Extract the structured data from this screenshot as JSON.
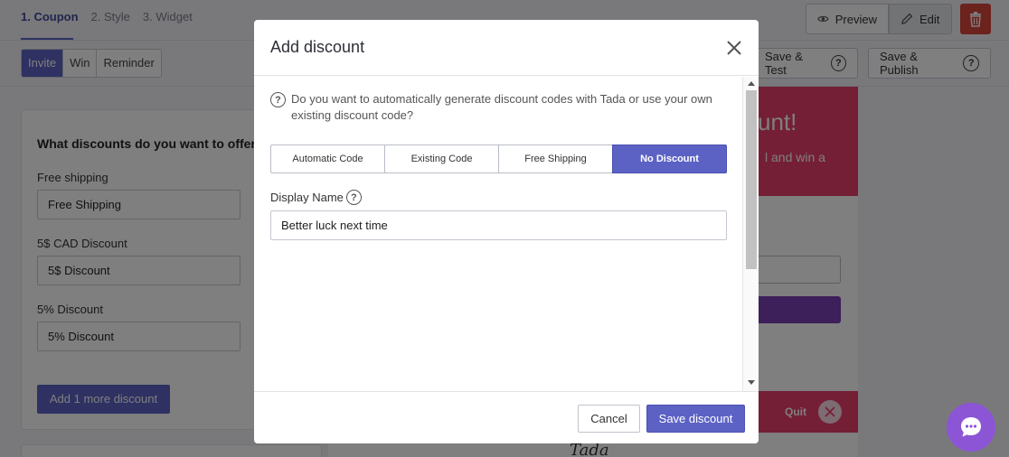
{
  "steps": [
    "1. Coupon",
    "2. Style",
    "3. Widget"
  ],
  "tabs": [
    "Invite",
    "Win",
    "Reminder"
  ],
  "header_buttons": {
    "preview": "Preview",
    "edit": "Edit",
    "save_test": "Save & Test",
    "save_publish": "Save & Publish",
    "help": "?"
  },
  "discount_panel": {
    "title": "What discounts do you want to offer?",
    "fields": [
      {
        "label": "Free shipping",
        "value": "Free Shipping"
      },
      {
        "label": "5$ CAD Discount",
        "value": "5$ Discount"
      },
      {
        "label": "5% Discount",
        "value": "5% Discount"
      }
    ],
    "add_button": "Add 1 more discount"
  },
  "preview": {
    "headline": "unt!",
    "subtext": "l and win a",
    "quit": "Quit",
    "logo": "Tada"
  },
  "modal": {
    "title": "Add discount",
    "question": "Do you want to automatically generate discount codes with Tada or use your own existing discount code?",
    "options": [
      "Automatic Code",
      "Existing Code",
      "Free Shipping",
      "No Discount"
    ],
    "selected_option": "No Discount",
    "display_name_label": "Display Name",
    "display_name_value": "Better luck next time",
    "help": "?",
    "cancel": "Cancel",
    "save": "Save discount"
  },
  "colors": {
    "primary": "#5c62c4",
    "danger": "#d9443a",
    "banner": "#e83e6c",
    "chat": "#8c55d6"
  }
}
